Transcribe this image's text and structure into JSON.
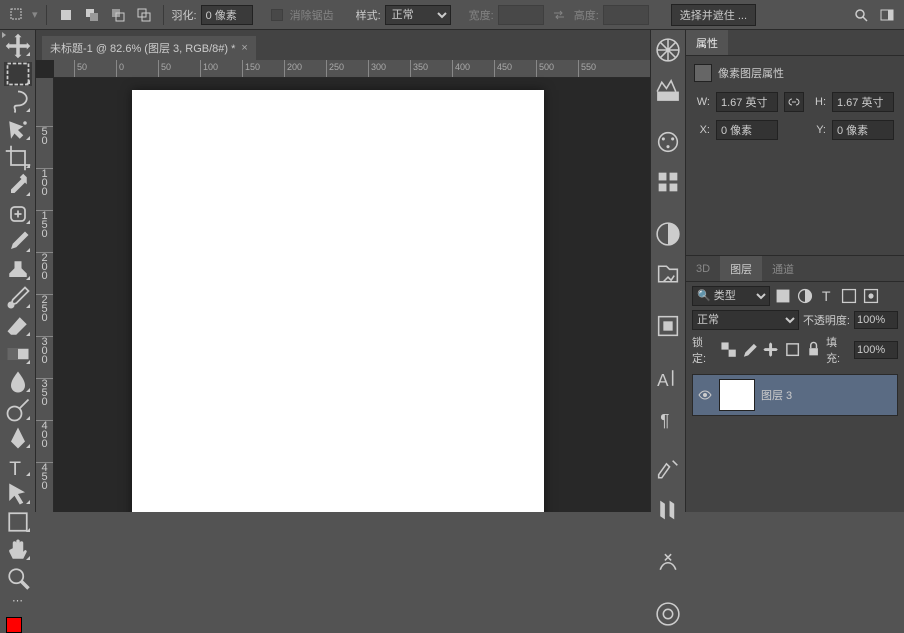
{
  "options_bar": {
    "feather_label": "羽化:",
    "feather_value": "0 像素",
    "antialias_label": "消除锯齿",
    "style_label": "样式:",
    "style_value": "正常",
    "width_label": "宽度:",
    "height_label": "高度:",
    "select_mask_btn": "选择并遮住 ..."
  },
  "document": {
    "tab_title": "未标题-1 @ 82.6% (图层 3, RGB/8#) *"
  },
  "hruler_ticks": [
    "50",
    "0",
    "50",
    "100",
    "150",
    "200",
    "250",
    "300",
    "350",
    "400",
    "450",
    "500",
    "550"
  ],
  "vruler_ticks": [
    "50",
    "100",
    "150",
    "200",
    "250",
    "300",
    "350",
    "400",
    "450"
  ],
  "panels": {
    "properties_tab": "属性",
    "props_title": "像素图层属性",
    "w_label": "W:",
    "w_value": "1.67 英寸",
    "h_label": "H:",
    "h_value": "1.67 英寸",
    "x_label": "X:",
    "x_value": "0 像素",
    "y_label": "Y:",
    "y_value": "0 像素",
    "tab_3d": "3D",
    "tab_layers": "图层",
    "tab_channels": "通道",
    "kind_label": "类型",
    "blend_value": "正常",
    "opacity_label": "不透明度:",
    "opacity_value": "100%",
    "lock_label": "锁定:",
    "fill_label": "填充:",
    "fill_value": "100%",
    "layer_name": "图层 3"
  },
  "search_icon": "🔍"
}
